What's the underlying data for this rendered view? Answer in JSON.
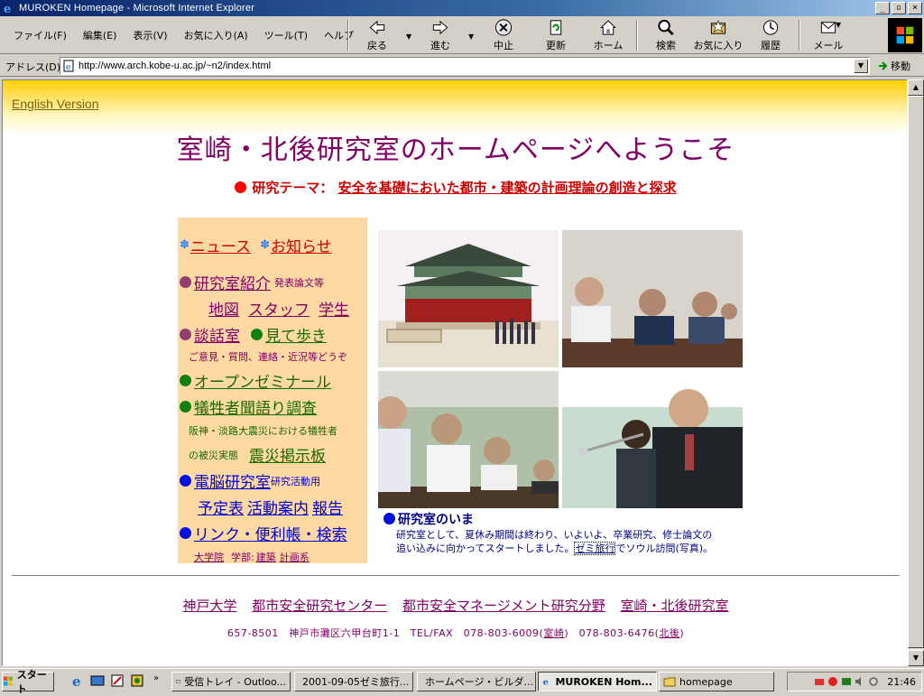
{
  "window": {
    "title": "MUROKEN Homepage - Microsoft Internet Explorer"
  },
  "menu": [
    "ファイル(F)",
    "編集(E)",
    "表示(V)",
    "お気に入り(A)",
    "ツール(T)",
    "ヘルプ"
  ],
  "toolbar": {
    "back": "戻る",
    "forward": "進む",
    "stop": "中止",
    "refresh": "更新",
    "home": "ホーム",
    "search": "検索",
    "favorites": "お気に入り",
    "history": "履歴",
    "mail": "メール"
  },
  "address": {
    "label": "アドレス(D)",
    "url": "http://www.arch.kobe-u.ac.jp/~n2/index.html",
    "go": "移動"
  },
  "page": {
    "english": "English Version",
    "title": "室崎・北後研究室のホームページへようこそ",
    "theme_label": "研究テーマ：",
    "theme_link": "安全を基礎においた都市・建築の計画理論の創造と探求",
    "menu": {
      "news": "ニュース",
      "notice": "お知らせ",
      "intro": "研究室紹介",
      "papers": "発表論文等",
      "map": "地図",
      "staff": "スタッフ",
      "students": "学生",
      "lounge": "談話室",
      "walk": "見て歩き",
      "lounge_note": "ご意見・質問、連絡・近況等どうぞ",
      "seminar": "オープンゼミナール",
      "survey": "犠牲者聞語り調査",
      "survey_note1": "阪神・淡路大震災における犠牲者",
      "survey_note2": "の被災実態",
      "board": "震災掲示板",
      "dennou": "電脳研究室",
      "dennou_note": "研究活動用",
      "schedule": "予定表",
      "activity": "活動案内",
      "report": "報告",
      "links": "リンク・便利帳・検索",
      "grad": "大学院",
      "faculty": "学部:",
      "arch": "建築",
      "plan": "計画系"
    },
    "caption": {
      "title": "研究室のいま",
      "line1": "研究室として、夏休み期間は終わり、いよいよ、卒業研究、修士論文の",
      "line2a": "追い込みに向かってスタートしました。",
      "line2link": "ゼミ旅行",
      "line2b": "でソウル訪問(写真)。"
    },
    "footer": {
      "links": [
        "神戸大学",
        "都市安全研究センター",
        "都市安全マネージメント研究分野",
        "室崎・北後研究室"
      ],
      "addr1": "657-8501　神戸市灘区六甲台町1-1　TEL/FAX　078-803-6009(",
      "addr_link1": "室崎",
      "addr2": ")　078-803-6476(",
      "addr_link2": "北後",
      "addr3": ")"
    }
  },
  "taskbar": {
    "start": "スタート",
    "tasks": [
      "受信トレイ - Outloo...",
      "2001-09-05ゼミ旅行...",
      "ホームページ・ビルダ...",
      "MUROKEN Hom...",
      "homepage"
    ],
    "clock": "21:46"
  }
}
